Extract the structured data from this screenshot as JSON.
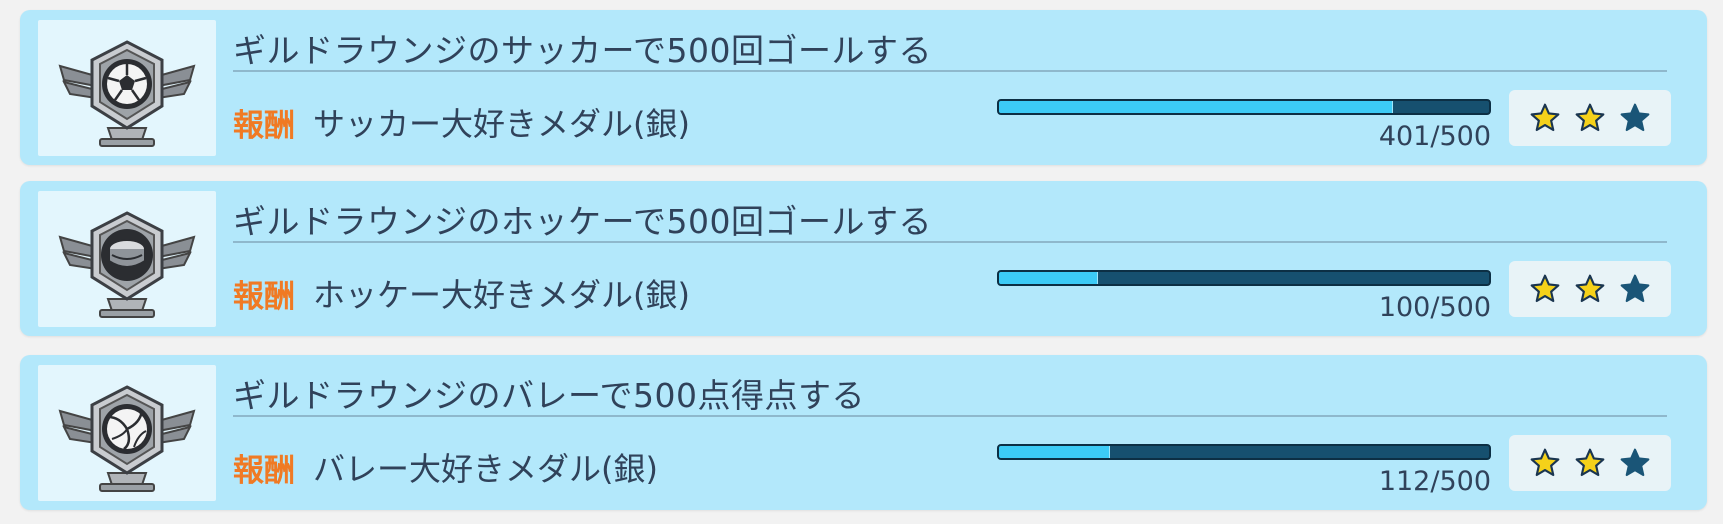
{
  "missions": [
    {
      "title": "ギルドラウンジのサッカーで500回ゴールする",
      "reward_label": "報酬",
      "reward_name": "サッカー大好きメダル(銀)",
      "progress_current": 401,
      "progress_max": 500,
      "progress_text": "401/500",
      "icon": "soccer-ball-medal-icon",
      "stars": [
        "filled",
        "filled",
        "dark"
      ]
    },
    {
      "title": "ギルドラウンジのホッケーで500回ゴールする",
      "reward_label": "報酬",
      "reward_name": "ホッケー大好きメダル(銀)",
      "progress_current": 100,
      "progress_max": 500,
      "progress_text": "100/500",
      "icon": "hockey-puck-medal-icon",
      "stars": [
        "filled",
        "filled",
        "dark"
      ]
    },
    {
      "title": "ギルドラウンジのバレーで500点得点する",
      "reward_label": "報酬",
      "reward_name": "バレー大好きメダル(銀)",
      "progress_current": 112,
      "progress_max": 500,
      "progress_text": "112/500",
      "icon": "volleyball-medal-icon",
      "stars": [
        "filled",
        "filled",
        "dark"
      ]
    }
  ],
  "colors": {
    "card_bg": "#b3e8fb",
    "reward_label": "#f07a24",
    "text": "#30425a",
    "bar_fill": "#3ccbf6",
    "bar_track": "#16506f",
    "star_gold": "#f5d11a",
    "star_dark": "#1a5577"
  }
}
